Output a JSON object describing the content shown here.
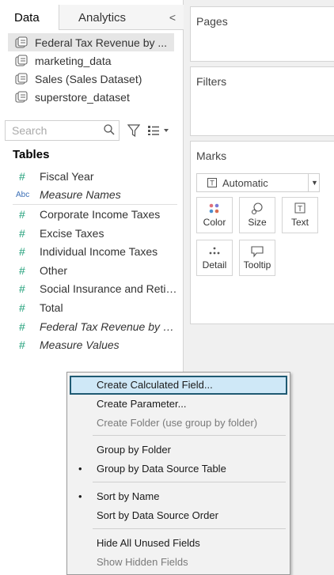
{
  "tabs": {
    "data": "Data",
    "analytics": "Analytics",
    "collapse": "<"
  },
  "data_sources": [
    {
      "label": "Federal Tax Revenue by ...",
      "selected": true
    },
    {
      "label": "marketing_data",
      "selected": false
    },
    {
      "label": "Sales (Sales Dataset)",
      "selected": false
    },
    {
      "label": "superstore_dataset",
      "selected": false
    }
  ],
  "search": {
    "placeholder": "Search"
  },
  "tables_header": "Tables",
  "fields_top": [
    {
      "glyph": "#",
      "label": "Fiscal Year",
      "italic": false
    },
    {
      "glyph": "Abc",
      "label": "Measure Names",
      "italic": true
    }
  ],
  "fields_bottom": [
    {
      "glyph": "#",
      "label": "Corporate Income Taxes",
      "italic": false
    },
    {
      "glyph": "#",
      "label": "Excise Taxes",
      "italic": false
    },
    {
      "glyph": "#",
      "label": "Individual Income Taxes",
      "italic": false
    },
    {
      "glyph": "#",
      "label": "Other",
      "italic": false
    },
    {
      "glyph": "#",
      "label": "Social Insurance and Retir...",
      "italic": false
    },
    {
      "glyph": "#",
      "label": "Total",
      "italic": false
    },
    {
      "glyph": "#",
      "label": "Federal Tax Revenue by S...",
      "italic": true
    },
    {
      "glyph": "#",
      "label": "Measure Values",
      "italic": true
    }
  ],
  "cards": {
    "pages": "Pages",
    "filters": "Filters",
    "marks": "Marks"
  },
  "marks": {
    "type": "Automatic",
    "buttons": {
      "color": "Color",
      "size": "Size",
      "text": "Text",
      "detail": "Detail",
      "tooltip": "Tooltip"
    }
  },
  "menu": {
    "create_calc": "Create Calculated Field...",
    "create_param": "Create Parameter...",
    "create_folder": "Create Folder (use group by folder)",
    "group_folder": "Group by Folder",
    "group_table": "Group by Data Source Table",
    "sort_name": "Sort by Name",
    "sort_order": "Sort by Data Source Order",
    "hide_unused": "Hide All Unused Fields",
    "show_hidden": "Show Hidden Fields",
    "bullet": "•"
  },
  "colors": {
    "measure_green": "#21a07a",
    "dimension_blue": "#3b6fb6",
    "highlight_border": "#1f5a73",
    "highlight_fill": "#cfe8f7"
  }
}
